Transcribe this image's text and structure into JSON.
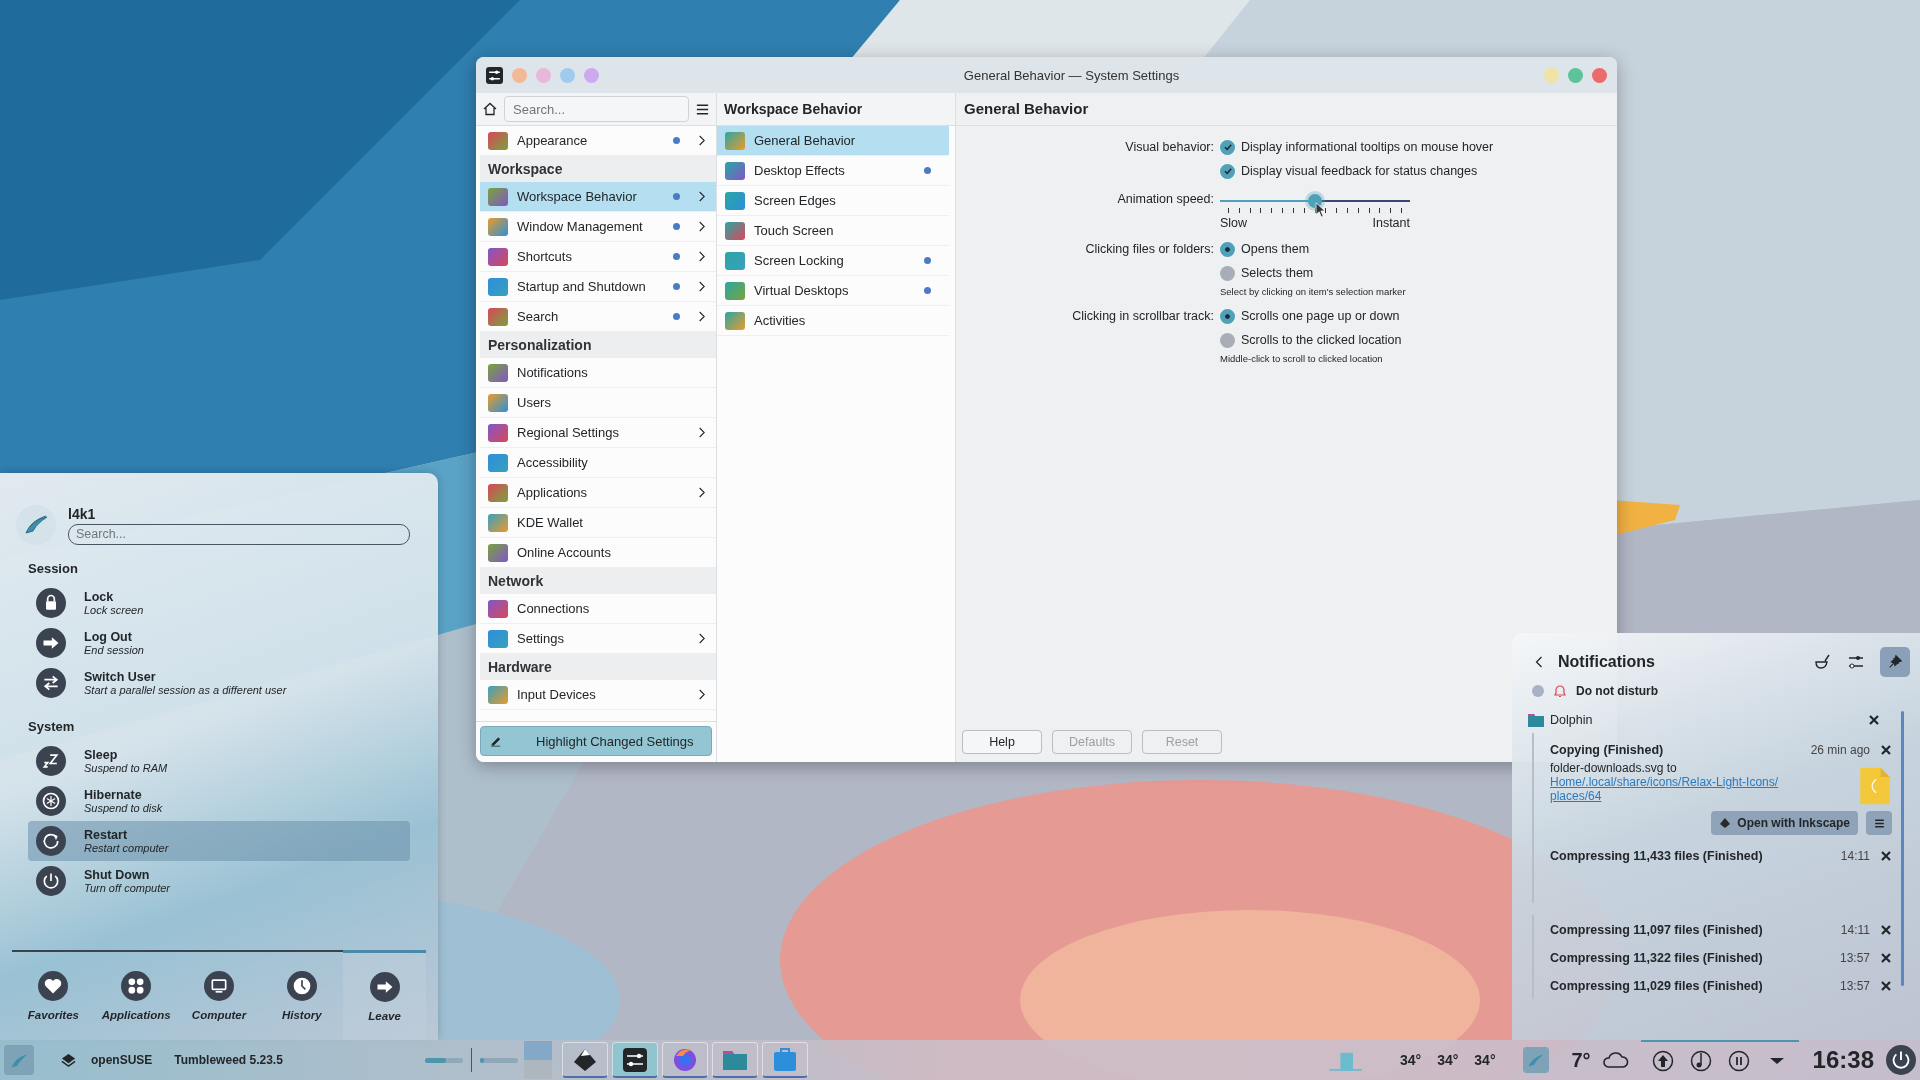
{
  "settings_window": {
    "title": "General Behavior — System Settings",
    "search": {
      "placeholder": "Search..."
    },
    "sidebar": [
      {
        "kind": "item",
        "label": "Appearance",
        "changed": true,
        "arrow": true,
        "selected": false
      },
      {
        "kind": "header",
        "label": "Workspace"
      },
      {
        "kind": "item",
        "label": "Workspace Behavior",
        "changed": true,
        "arrow": true,
        "selected": true
      },
      {
        "kind": "item",
        "label": "Window Management",
        "changed": true,
        "arrow": true,
        "selected": false
      },
      {
        "kind": "item",
        "label": "Shortcuts",
        "changed": true,
        "arrow": true,
        "selected": false
      },
      {
        "kind": "item",
        "label": "Startup and Shutdown",
        "changed": true,
        "arrow": true,
        "selected": false
      },
      {
        "kind": "item",
        "label": "Search",
        "changed": true,
        "arrow": true,
        "selected": false
      },
      {
        "kind": "header",
        "label": "Personalization"
      },
      {
        "kind": "item",
        "label": "Notifications",
        "changed": false,
        "arrow": false,
        "selected": false
      },
      {
        "kind": "item",
        "label": "Users",
        "changed": false,
        "arrow": false,
        "selected": false
      },
      {
        "kind": "item",
        "label": "Regional Settings",
        "changed": false,
        "arrow": true,
        "selected": false
      },
      {
        "kind": "item",
        "label": "Accessibility",
        "changed": false,
        "arrow": false,
        "selected": false
      },
      {
        "kind": "item",
        "label": "Applications",
        "changed": false,
        "arrow": true,
        "selected": false
      },
      {
        "kind": "item",
        "label": "KDE Wallet",
        "changed": false,
        "arrow": false,
        "selected": false
      },
      {
        "kind": "item",
        "label": "Online Accounts",
        "changed": false,
        "arrow": false,
        "selected": false
      },
      {
        "kind": "header",
        "label": "Network"
      },
      {
        "kind": "item",
        "label": "Connections",
        "changed": false,
        "arrow": false,
        "selected": false
      },
      {
        "kind": "item",
        "label": "Settings",
        "changed": false,
        "arrow": true,
        "selected": false
      },
      {
        "kind": "header",
        "label": "Hardware"
      },
      {
        "kind": "item",
        "label": "Input Devices",
        "changed": false,
        "arrow": true,
        "selected": false
      }
    ],
    "highlight_button": {
      "label": "Highlight Changed Settings",
      "checked": true
    },
    "sub_panel": {
      "title": "Workspace Behavior",
      "items": [
        {
          "label": "General Behavior",
          "changed": false,
          "selected": true
        },
        {
          "label": "Desktop Effects",
          "changed": true,
          "selected": false
        },
        {
          "label": "Screen Edges",
          "changed": false,
          "selected": false
        },
        {
          "label": "Touch Screen",
          "changed": false,
          "selected": false
        },
        {
          "label": "Screen Locking",
          "changed": true,
          "selected": false
        },
        {
          "label": "Virtual Desktops",
          "changed": true,
          "selected": false
        },
        {
          "label": "Activities",
          "changed": false,
          "selected": false
        }
      ]
    },
    "page": {
      "title": "General Behavior",
      "rows": [
        {
          "kind": "checks",
          "label": "Visual behavior:",
          "options": [
            {
              "label": "Display informational tooltips on mouse hover",
              "checked": true
            },
            {
              "label": "Display visual feedback for status changes",
              "checked": true
            }
          ]
        },
        {
          "kind": "slider",
          "label": "Animation speed:",
          "level": 0.5,
          "min_label": "Slow",
          "max_label": "Instant"
        },
        {
          "kind": "radios",
          "label": "Clicking files or folders:",
          "options": [
            {
              "label": "Opens them",
              "selected": true
            },
            {
              "label": "Selects them",
              "selected": false
            }
          ],
          "hint": "Select by clicking on item's selection marker"
        },
        {
          "kind": "radios",
          "label": "Clicking in scrollbar track:",
          "options": [
            {
              "label": "Scrolls one page up or down",
              "selected": true
            },
            {
              "label": "Scrolls to the clicked location",
              "selected": false
            }
          ],
          "hint": "Middle-click to scroll to clicked location"
        }
      ],
      "buttons": [
        {
          "label": "Help",
          "disabled": false
        },
        {
          "label": "Defaults",
          "disabled": true
        },
        {
          "label": "Reset",
          "disabled": true
        }
      ]
    }
  },
  "launcher": {
    "user": "l4k1",
    "search": {
      "placeholder": "Search..."
    },
    "sections": [
      {
        "title": "Session",
        "items": [
          {
            "title": "Lock",
            "subtitle": "Lock screen",
            "selected": false
          },
          {
            "title": "Log Out",
            "subtitle": "End session",
            "selected": false
          },
          {
            "title": "Switch User",
            "subtitle": "Start a parallel session as a different user",
            "selected": false
          }
        ]
      },
      {
        "title": "System",
        "items": [
          {
            "title": "Sleep",
            "subtitle": "Suspend to RAM",
            "selected": false
          },
          {
            "title": "Hibernate",
            "subtitle": "Suspend to disk",
            "selected": false
          },
          {
            "title": "Restart",
            "subtitle": "Restart computer",
            "selected": true
          },
          {
            "title": "Shut Down",
            "subtitle": "Turn off computer",
            "selected": false
          }
        ]
      }
    ],
    "tabs": [
      {
        "label": "Favorites",
        "selected": false
      },
      {
        "label": "Applications",
        "selected": false
      },
      {
        "label": "Computer",
        "selected": false
      },
      {
        "label": "History",
        "selected": false
      },
      {
        "label": "Leave",
        "selected": true
      }
    ]
  },
  "notifications": {
    "title": "Notifications",
    "pinned": true,
    "do_not_disturb": {
      "label": "Do not disturb",
      "on": false
    },
    "group": "Dolphin",
    "items": [
      {
        "kind": "detailed",
        "title": "Copying (Finished)",
        "time": "26 min ago",
        "body": "folder-downloads.svg to",
        "link": "Home/.local/share/icons/Relax-Light-Icons/places/64",
        "action": "Open with Inkscape"
      },
      {
        "kind": "simple",
        "title": "Compressing 11,433 files (Finished)",
        "time": "14:11"
      },
      {
        "kind": "simple",
        "title": "Compressing 11,097 files (Finished)",
        "time": "14:11"
      },
      {
        "kind": "simple",
        "title": "Compressing 11,322 files (Finished)",
        "time": "13:57"
      },
      {
        "kind": "simple",
        "title": "Compressing 11,029 files (Finished)",
        "time": "13:57"
      }
    ]
  },
  "taskbar": {
    "distro": "openSUSE",
    "version": "Tumbleweed 5.23.5",
    "meters": [
      {
        "level": 0.55
      },
      {
        "level": 0.12
      }
    ],
    "desktops": [
      {
        "selected": true
      },
      {
        "selected": false
      }
    ],
    "tasks": [
      {
        "selected": false
      },
      {
        "selected": true
      },
      {
        "selected": false
      },
      {
        "selected": false
      },
      {
        "selected": false
      }
    ],
    "temperatures": [
      "34°",
      "34°",
      "34°"
    ],
    "weather": "7°",
    "clock": "16:38"
  }
}
